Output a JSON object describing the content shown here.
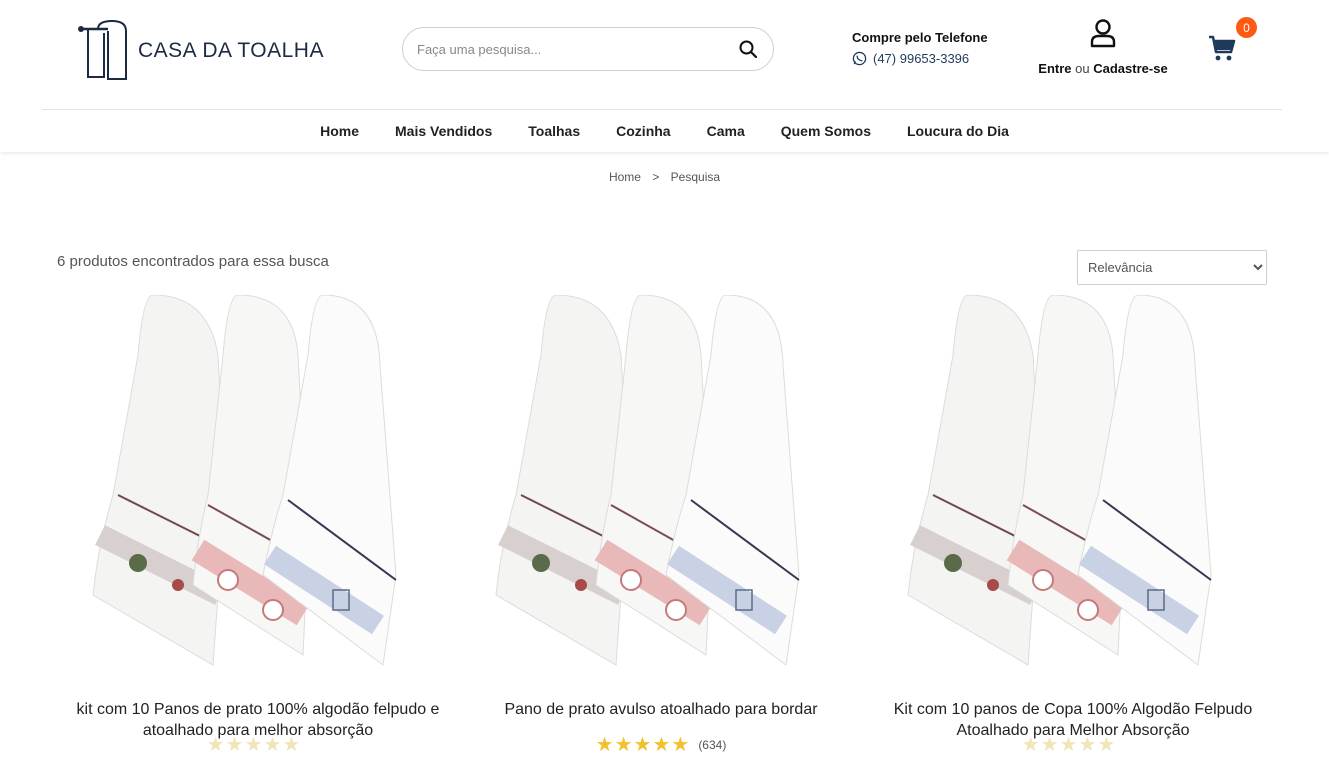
{
  "brand": {
    "name": "CASA DA TOALHA"
  },
  "search": {
    "placeholder": "Faça uma pesquisa..."
  },
  "contact": {
    "title": "Compre pelo Telefone",
    "phone": "(47) 99653-3396"
  },
  "account": {
    "login": "Entre",
    "or": "ou",
    "register": "Cadastre-se"
  },
  "cart": {
    "count": "0"
  },
  "nav": [
    "Home",
    "Mais Vendidos",
    "Toalhas",
    "Cozinha",
    "Cama",
    "Quem Somos",
    "Loucura do Dia"
  ],
  "breadcrumb": {
    "home": "Home",
    "separator": ">",
    "current": "Pesquisa"
  },
  "results": {
    "count_text": "6 produtos encontrados para essa busca",
    "sort_selected": "Relevância"
  },
  "colors": {
    "accent_orange": "#ff5a14",
    "navy": "#1d2a44",
    "star": "#f2c12e"
  },
  "products": [
    {
      "title": "kit com 10 Panos de prato 100% algodão felpudo e atoalhado para melhor absorção",
      "rating_count": "",
      "stars": 5
    },
    {
      "title": "Pano de prato avulso atoalhado para bordar",
      "rating_count": "(634)",
      "stars": 5
    },
    {
      "title": "Kit com 10 panos de Copa 100% Algodão Felpudo Atoalhado para Melhor Absorção",
      "rating_count": "",
      "stars": 5
    }
  ]
}
